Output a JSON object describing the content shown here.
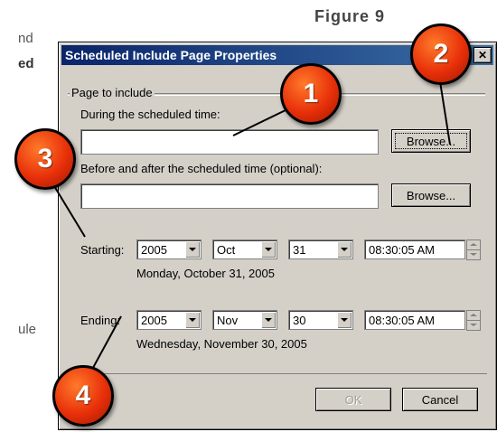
{
  "side_text": {
    "line1": "nd",
    "line2": "ed",
    "line3": "ule"
  },
  "figure_caption": "Figure 9",
  "dialog": {
    "title": "Scheduled Include Page Properties",
    "close_glyph": "✕",
    "group_label": "Page to include",
    "during_label": "During the scheduled time:",
    "during_value": "",
    "browse_label_1": "Browse...",
    "before_after_label": "Before and after the scheduled time (optional):",
    "before_after_value": "",
    "browse_label_2": "Browse...",
    "starting": {
      "label": "Starting:",
      "year": "2005",
      "month": "Oct",
      "day": "31",
      "time": "08:30:05 AM",
      "long_date": "Monday, October 31, 2005"
    },
    "ending": {
      "label": "Ending:",
      "year": "2005",
      "month": "Nov",
      "day": "30",
      "time": "08:30:05 AM",
      "long_date": "Wednesday, November 30, 2005"
    },
    "ok_label": "OK",
    "cancel_label": "Cancel"
  },
  "callouts": {
    "one": "1",
    "two": "2",
    "three": "3",
    "four": "4"
  },
  "colors": {
    "titlebar": "#0a246a",
    "dialog_bg": "#d4d0c8",
    "callout_fill": "#e8300a"
  }
}
